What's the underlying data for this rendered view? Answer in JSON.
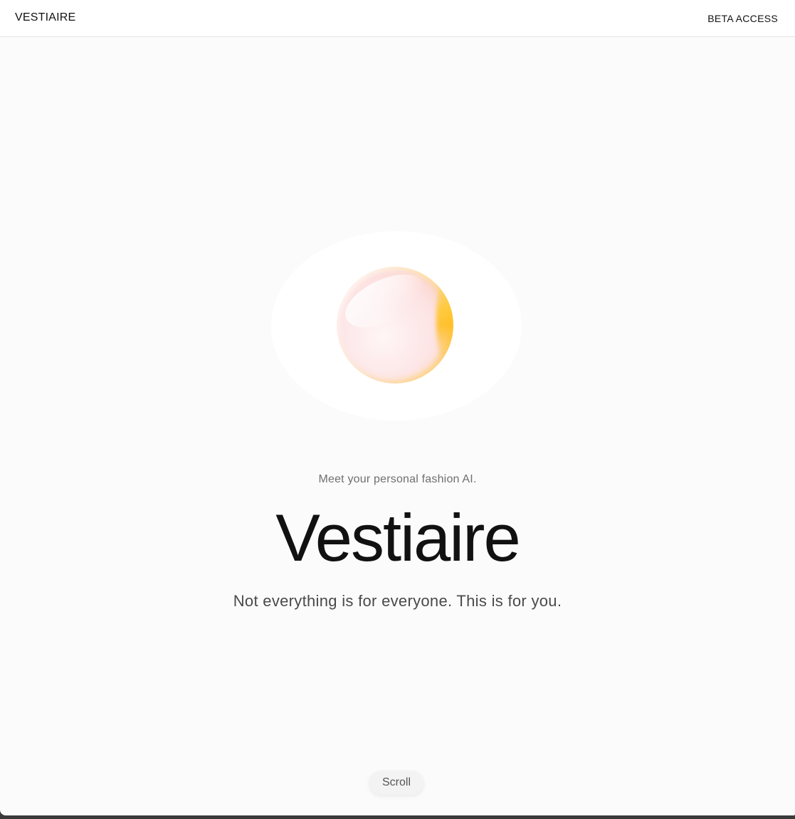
{
  "header": {
    "brand": "VESTIAIRE",
    "beta_access": "BETA ACCESS"
  },
  "hero": {
    "tagline": "Meet your personal fashion AI.",
    "title": "Vestiaire",
    "subtitle": "Not everything is for everyone. This is for you.",
    "scroll_label": "Scroll"
  },
  "colors": {
    "page_background": "#fbfbfb",
    "header_background": "#ffffff",
    "text_primary": "#111111",
    "text_muted": "#6f6f6f",
    "orb_accent": "#ffc828",
    "orb_tint": "#fde8e8"
  },
  "icons": {
    "orb": "gradient-orb-graphic"
  }
}
